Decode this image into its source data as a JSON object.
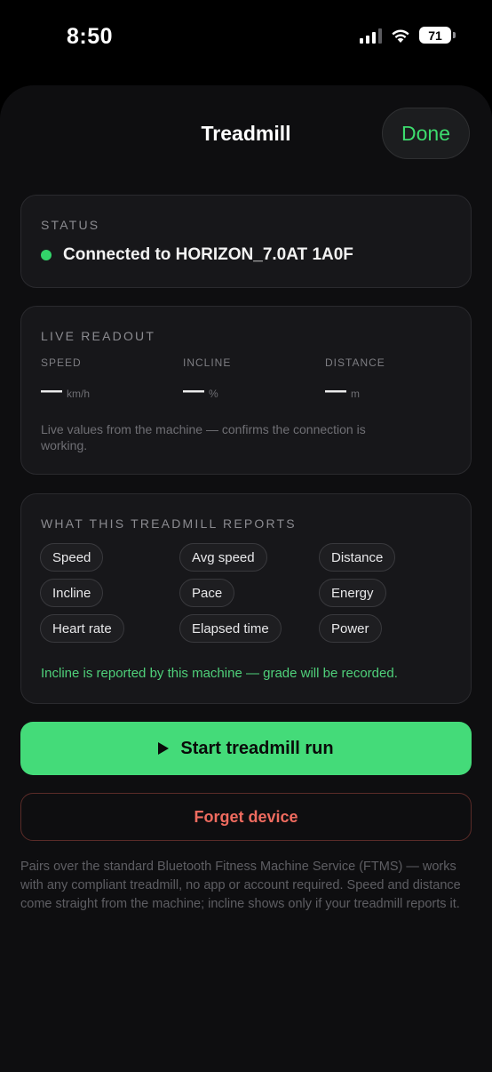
{
  "status_bar": {
    "time": "8:50",
    "battery": "71"
  },
  "header": {
    "title": "Treadmill",
    "done_label": "Done"
  },
  "status": {
    "label": "STATUS",
    "text": "Connected to HORIZON_7.0AT 1A0F",
    "dot_color": "#33d46a"
  },
  "live": {
    "label": "LIVE READOUT",
    "metrics": [
      {
        "label": "SPEED",
        "value": "—",
        "unit": "km/h"
      },
      {
        "label": "INCLINE",
        "value": "—",
        "unit": "%"
      },
      {
        "label": "DISTANCE",
        "value": "—",
        "unit": "m"
      }
    ],
    "note": "Live values from the machine — confirms the connection is working."
  },
  "reports": {
    "label": "WHAT THIS TREADMILL REPORTS",
    "chips": [
      "Speed",
      "Avg speed",
      "Distance",
      "Incline",
      "Pace",
      "Energy",
      "Heart rate",
      "Elapsed time",
      "Power"
    ],
    "note": "Incline is reported by this machine — grade will be recorded."
  },
  "actions": {
    "start_label": "Start treadmill run",
    "forget_label": "Forget device"
  },
  "footer": "Pairs over the standard Bluetooth Fitness Machine Service (FTMS) — works with any compliant treadmill, no app or account required. Speed and distance come straight from the machine; incline shows only if your treadmill reports it.",
  "colors": {
    "accent": "#44db79",
    "danger": "#ef6b5f",
    "background": "#0e0e10"
  }
}
